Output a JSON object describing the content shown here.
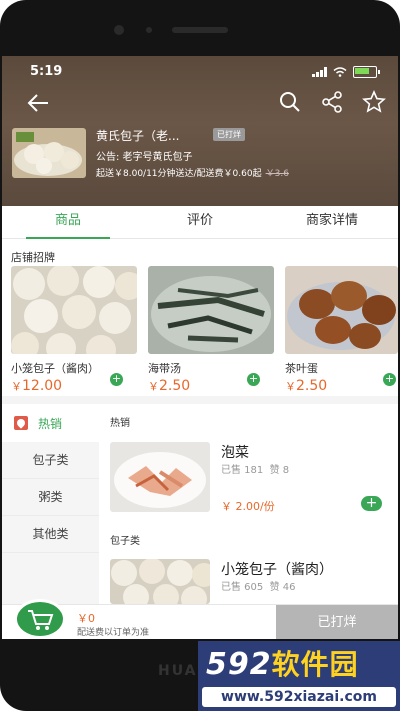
{
  "status": {
    "time": "5:19"
  },
  "store": {
    "name": "黄氏包子（老...",
    "status_badge": "已打烊",
    "notice": "公告: 老字号黄氏包子",
    "delivery": "起送￥8.00/11分钟送达/配送费￥0.60起",
    "original_fee": "￥3.6"
  },
  "tabs": [
    {
      "label": "商品",
      "active": true
    },
    {
      "label": "评价"
    },
    {
      "label": "商家详情"
    }
  ],
  "recommend": {
    "title": "店铺招牌",
    "items": [
      {
        "name": "小笼包子（酱肉）",
        "price": "12.00",
        "currency": "￥"
      },
      {
        "name": "海带汤",
        "price": "2.50",
        "currency": "￥"
      },
      {
        "name": "茶叶蛋",
        "price": "2.50",
        "currency": "￥"
      }
    ]
  },
  "side_menu": {
    "hot": "热销",
    "items": [
      "包子类",
      "粥类",
      "其他类"
    ]
  },
  "list": [
    {
      "category": "热销",
      "name": "泡菜",
      "sold": "已售 181",
      "likes": "赞 8",
      "price": "￥ 2.00/份"
    },
    {
      "category": "包子类",
      "name": "小笼包子（酱肉）",
      "sold": "已售 605",
      "likes": "赞 46"
    }
  ],
  "cart": {
    "total": "￥0",
    "note": "配送费以订单为准",
    "checkout": "已打烊"
  },
  "device_brand": "HUA",
  "watermark": {
    "logo_num": "592",
    "logo_text": "软件园",
    "url": "www.592xiazai.com"
  },
  "colors": {
    "accent": "#3aa757",
    "price": "#e8682c",
    "header": "#5b4a3c"
  }
}
